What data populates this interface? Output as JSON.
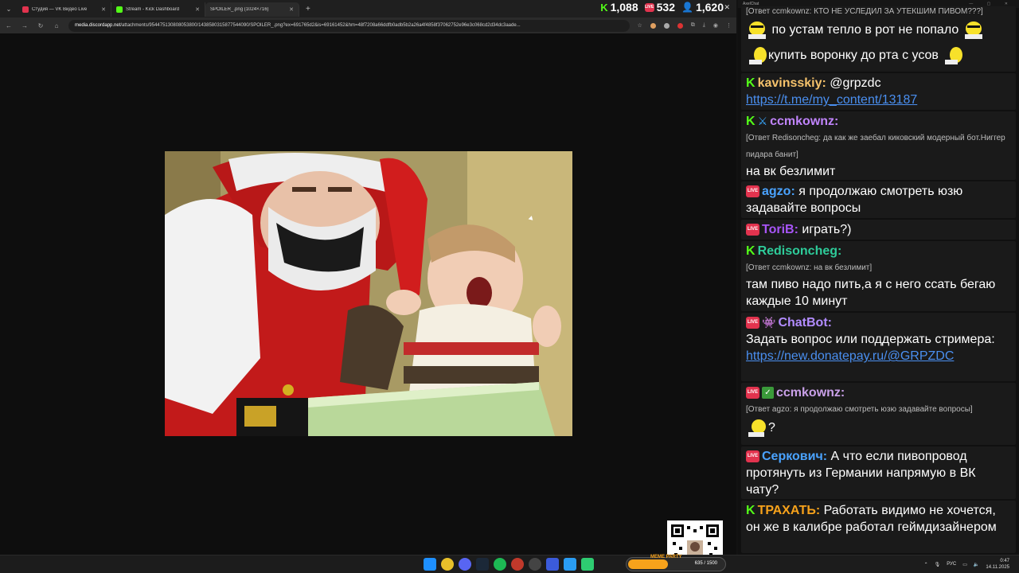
{
  "tabs": [
    {
      "label": "Студия — VK Видео Live",
      "color": "#e2334e"
    },
    {
      "label": "Stream - Kick Dashboard",
      "color": "#53fc18"
    },
    {
      "label": "SPOILER_.png (1024×716)",
      "color": "#888888"
    }
  ],
  "counters": {
    "kick": "1,088",
    "vk": "532",
    "viewers": "1,620"
  },
  "address": {
    "host": "media.discordapp.net",
    "path": "/attachments/954475130808053800/1438580315877544090/SPOILER_.png?ex=691765d2&is=69161452&hm=48f7208a66ddfb0adb5b2a26a4f4858f37062752e96e3c068cd2d34dc3aade..."
  },
  "chat": {
    "title": "AxelChat",
    "messages": [
      {
        "reply": "[Ответ ccmkownz: КТО НЕ УСЛЕДИЛ ЗА УТЕКШИМ ПИВОМ???]",
        "line1": "по устам тепло в рот не попало",
        "line2": "купить воронку до рта с усов"
      },
      {
        "badge": "kick",
        "name": "kavinsskiy:",
        "name_color": "#f5c26b",
        "text": "@grpzdc",
        "link": "https://t.me/my_content/13187"
      },
      {
        "badge": "kick",
        "badge2": "sword",
        "name": "ccmkownz:",
        "name_color": "#c084fc",
        "reply": "[Ответ Redisoncheg: да как же заебал киковский модерный бот.Ниггер пидара банит]",
        "text": "на вк безлимит"
      },
      {
        "badge": "live",
        "name": "agzo:",
        "name_color": "#4aa3ff",
        "text": "я продолжаю смотреть юзю задавайте вопросы"
      },
      {
        "badge": "live",
        "name": "ToriB:",
        "name_color": "#a855f7",
        "text": "играть?)"
      },
      {
        "badge": "kick",
        "name": "Redisoncheg:",
        "name_color": "#2ecc9a",
        "reply": "[Ответ ccmkownz: на вк безлимит]",
        "text": "там пиво надо пить,а я с него ссать бегаю каждые 10 минут"
      },
      {
        "badge": "live",
        "badge2": "bot",
        "name": "ChatBot:",
        "name_color": "#b28cff",
        "text": "Задать вопрос или поддержать стримера:",
        "link": "https://new.donatepay.ru/@GRPZDC"
      },
      {
        "badge": "live",
        "badge2": "check",
        "name": "ccmkownz:",
        "name_color": "#c9a0e8",
        "reply": "[Ответ agzo: я продолжаю смотреть юзю задавайте вопросы]",
        "text": "?"
      },
      {
        "badge": "live",
        "name": "Серкович:",
        "name_color": "#4aa3ff",
        "text": "А что если пивопровод протянуть из Германии напрямую в ВК чату?"
      },
      {
        "badge": "kick",
        "name": "ТРАХАТЬ:",
        "name_color": "#f7a21b",
        "text": "Работать видимо не хочется, он же в калибре работал геймдизайнером"
      }
    ]
  },
  "meme_party": {
    "label": "MEME PARTY",
    "value": "635 / 1500",
    "progress": 0.42
  },
  "tray": {
    "lang": "РУС",
    "time": "0:47",
    "date": "14.11.2025"
  }
}
